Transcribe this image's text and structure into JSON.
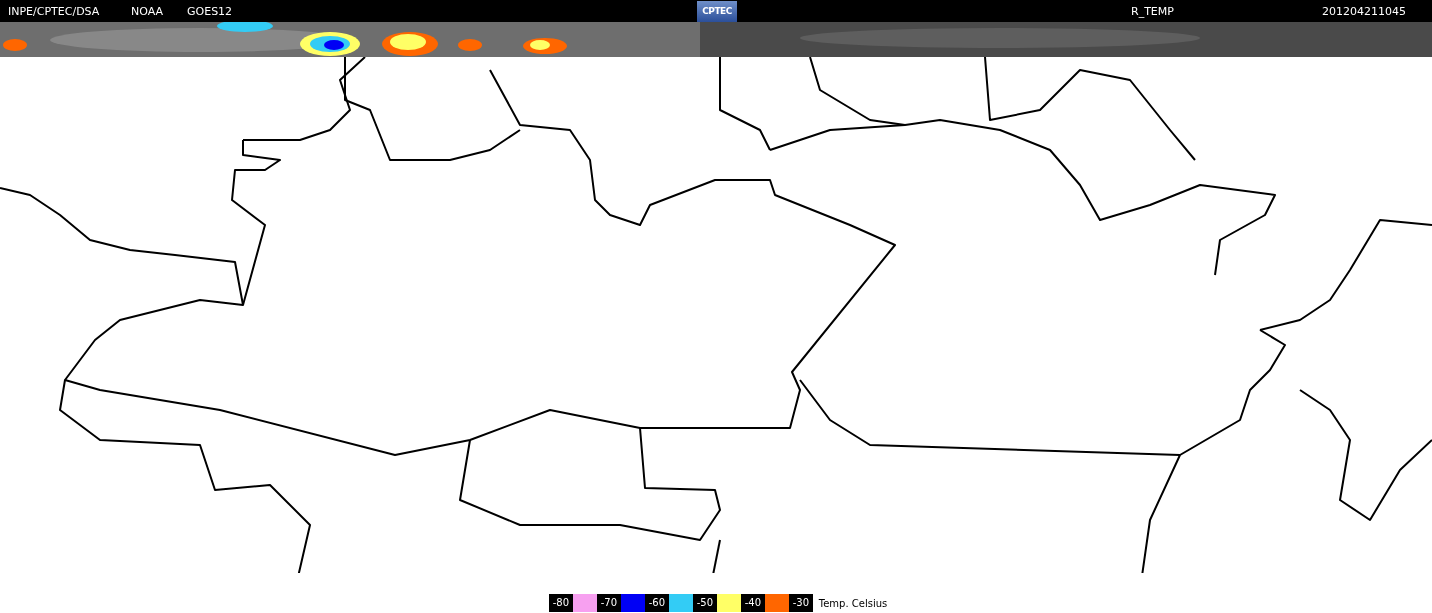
{
  "header": {
    "source": "INPE/CPTEC/DSA",
    "agency": "NOAA",
    "satellite": "GOES12",
    "logo": "CPTEC",
    "product": "R_TEMP",
    "timestamp": "201204211045"
  },
  "legend": {
    "items": [
      {
        "label": "-80",
        "color": "#f7a0f0"
      },
      {
        "label": "-70",
        "color": "#0000f5"
      },
      {
        "label": "-60",
        "color": "#33ccf5"
      },
      {
        "label": "-50",
        "color": "#ffff66"
      },
      {
        "label": "-40",
        "color": "#ff6600"
      },
      {
        "label": "-30"
      }
    ],
    "unit": "Temp. Celsius"
  }
}
